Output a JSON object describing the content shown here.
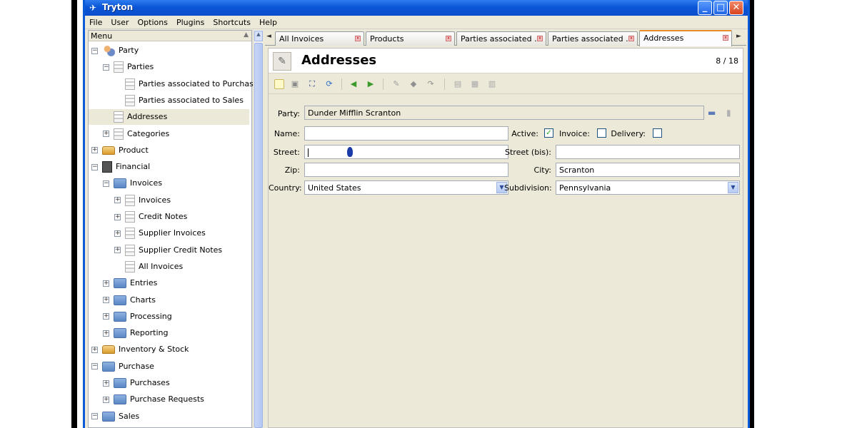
{
  "window": {
    "title": "Tryton",
    "controls": {
      "minimize": "_",
      "maximize": "□",
      "close": "✕"
    }
  },
  "menubar": [
    "File",
    "User",
    "Options",
    "Plugins",
    "Shortcuts",
    "Help"
  ],
  "sidebar": {
    "header": "Menu",
    "collapse_icon": "chevron-up-icon",
    "tree": [
      {
        "label": "Party",
        "level": 0,
        "expander": "−",
        "icon": "party"
      },
      {
        "label": "Parties",
        "level": 1,
        "expander": "−",
        "icon": "doc"
      },
      {
        "label": "Parties associated to Purchases",
        "level": 2,
        "expander": "",
        "icon": "doc"
      },
      {
        "label": "Parties associated to Sales",
        "level": 2,
        "expander": "",
        "icon": "doc"
      },
      {
        "label": "Addresses",
        "level": 1,
        "expander": "",
        "icon": "doc",
        "selected": true
      },
      {
        "label": "Categories",
        "level": 1,
        "expander": "+",
        "icon": "doc"
      },
      {
        "label": "Product",
        "level": 0,
        "expander": "+",
        "icon": "box"
      },
      {
        "label": "Financial",
        "level": 0,
        "expander": "−",
        "icon": "calc"
      },
      {
        "label": "Invoices",
        "level": 1,
        "expander": "−",
        "icon": "folder"
      },
      {
        "label": "Invoices",
        "level": 2,
        "expander": "+",
        "icon": "doc"
      },
      {
        "label": "Credit Notes",
        "level": 2,
        "expander": "+",
        "icon": "doc"
      },
      {
        "label": "Supplier Invoices",
        "level": 2,
        "expander": "+",
        "icon": "doc"
      },
      {
        "label": "Supplier Credit Notes",
        "level": 2,
        "expander": "+",
        "icon": "doc"
      },
      {
        "label": "All Invoices",
        "level": 2,
        "expander": "",
        "icon": "doc"
      },
      {
        "label": "Entries",
        "level": 1,
        "expander": "+",
        "icon": "folder"
      },
      {
        "label": "Charts",
        "level": 1,
        "expander": "+",
        "icon": "folder"
      },
      {
        "label": "Processing",
        "level": 1,
        "expander": "+",
        "icon": "folder"
      },
      {
        "label": "Reporting",
        "level": 1,
        "expander": "+",
        "icon": "folder"
      },
      {
        "label": "Inventory & Stock",
        "level": 0,
        "expander": "+",
        "icon": "box"
      },
      {
        "label": "Purchase",
        "level": 0,
        "expander": "−",
        "icon": "folder"
      },
      {
        "label": "Purchases",
        "level": 1,
        "expander": "+",
        "icon": "folder"
      },
      {
        "label": "Purchase Requests",
        "level": 1,
        "expander": "+",
        "icon": "folder"
      },
      {
        "label": "Sales",
        "level": 0,
        "expander": "−",
        "icon": "folder"
      }
    ]
  },
  "tabs": [
    {
      "label": "All Invoices",
      "active": false
    },
    {
      "label": "Products",
      "active": false
    },
    {
      "label": "Parties associated ...",
      "active": false
    },
    {
      "label": "Parties associated ...",
      "active": false
    },
    {
      "label": "Addresses",
      "active": true
    }
  ],
  "tab_scroll": {
    "left": "◄",
    "right": "►"
  },
  "form_header": {
    "title": "Addresses",
    "record_counter": "8 / 18",
    "icon": "wand-icon"
  },
  "toolbar_icons": [
    "new-icon",
    "save-icon",
    "switch-view-icon",
    "reload-icon",
    "previous-icon",
    "next-icon",
    "attachment-icon",
    "action-icon",
    "relate-icon",
    "report-icon",
    "email-icon",
    "print-icon"
  ],
  "form": {
    "party_label": "Party:",
    "party_value": "Dunder Mifflin Scranton",
    "name_label": "Name:",
    "name_value": "",
    "active_label": "Active:",
    "active_checked": true,
    "invoice_label": "Invoice:",
    "invoice_checked": false,
    "delivery_label": "Delivery:",
    "delivery_checked": false,
    "street_label": "Street:",
    "street_value": "",
    "street_bis_label": "Street (bis):",
    "street_bis_value": "",
    "zip_label": "Zip:",
    "zip_value": "",
    "city_label": "City:",
    "city_value": "Scranton",
    "country_label": "Country:",
    "country_value": "United States",
    "subdivision_label": "Subdivision:",
    "subdivision_value": "Pennsylvania"
  },
  "colors": {
    "titlebar": "#0a56d6",
    "active_tab_accent": "#e68b2c",
    "checkbox_check": "#21a121",
    "window_bg": "#ece9d8"
  }
}
